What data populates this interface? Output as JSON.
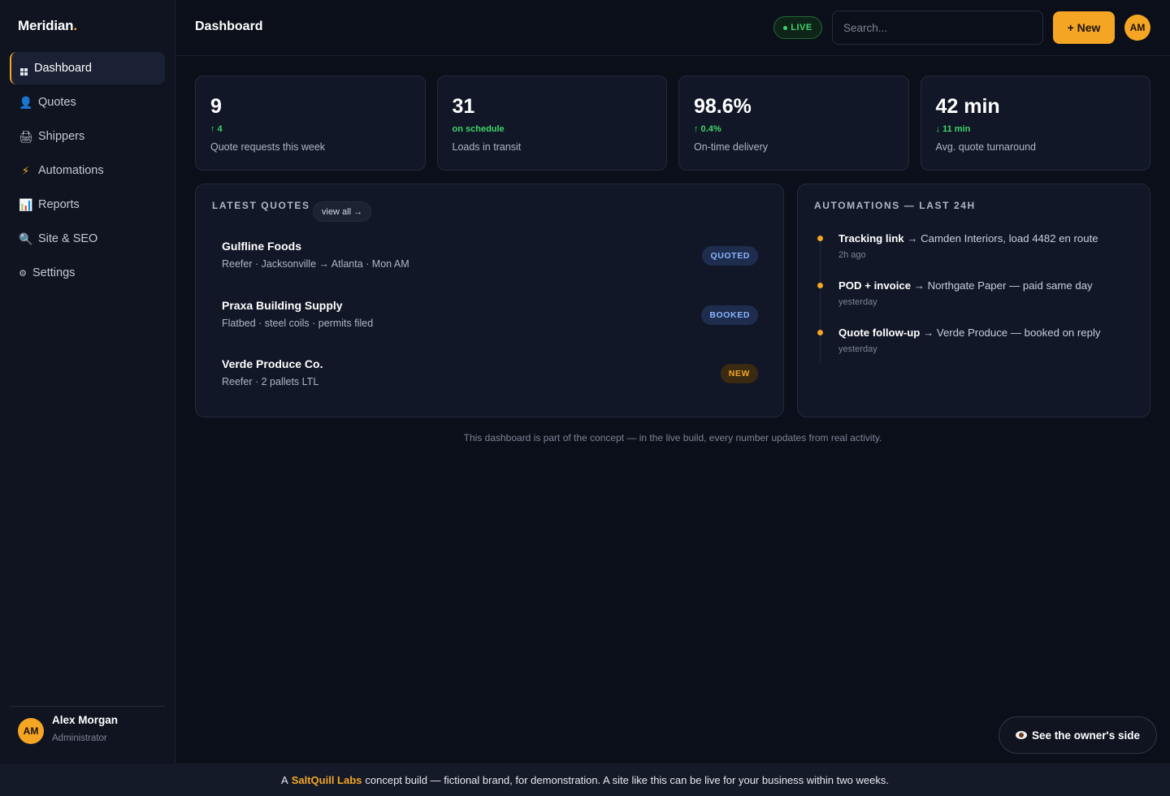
{
  "brand": {
    "name": "Meridian",
    "dot": "."
  },
  "nav": [
    {
      "label": "Dashboard",
      "icon": "grid-icon",
      "active": true
    },
    {
      "label": "Quotes",
      "icon": "user-icon",
      "glyph": "👤"
    },
    {
      "label": "Shippers",
      "icon": "printer-icon",
      "glyph": "🖨"
    },
    {
      "label": "Automations",
      "icon": "lightning-icon",
      "glyph": "⚡"
    },
    {
      "label": "Reports",
      "icon": "bar-chart-icon",
      "glyph": "📊"
    },
    {
      "label": "Site & SEO",
      "icon": "magnifier-icon",
      "glyph": "🔍"
    },
    {
      "label": "Settings",
      "icon": "gear-icon",
      "glyph": "⚙"
    }
  ],
  "user": {
    "initials": "AM",
    "name": "Alex Morgan",
    "role": "Administrator"
  },
  "header": {
    "title": "Dashboard",
    "live": "LIVE",
    "search_placeholder": "Search...",
    "new_label": "+ New",
    "avatar": "AM"
  },
  "stats": [
    {
      "value": "9",
      "delta": "↑ 4",
      "label": "Quote requests this week"
    },
    {
      "value": "31",
      "delta": "on schedule",
      "label": "Loads in transit"
    },
    {
      "value": "98.6%",
      "delta": "↑ 0.4%",
      "label": "On-time delivery"
    },
    {
      "value": "42 min",
      "delta": "↓ 11 min",
      "label": "Avg. quote turnaround"
    }
  ],
  "quotes": {
    "title": "Latest quotes",
    "view_all": "view all →",
    "items": [
      {
        "name": "Gulfline Foods",
        "meta": "Reefer · Jacksonville → Atlanta · Mon AM",
        "status": "QUOTED"
      },
      {
        "name": "Praxa Building Supply",
        "meta": "Flatbed · steel coils · permits filed",
        "status": "BOOKED"
      },
      {
        "name": "Verde Produce Co.",
        "meta": "Reefer · 2 pallets LTL",
        "status": "NEW"
      }
    ]
  },
  "automations": {
    "title": "Automations — last 24h",
    "items": [
      {
        "name": "Tracking link",
        "text": " → Camden Interiors, load 4482 en route",
        "time": "2h ago"
      },
      {
        "name": "POD + invoice",
        "text": " → Northgate Paper — paid same day",
        "time": "yesterday"
      },
      {
        "name": "Quote follow-up",
        "text": " → Verde Produce — booked on reply",
        "time": "yesterday"
      }
    ]
  },
  "note": "This dashboard is part of the concept — in the live build, every number updates from real activity.",
  "owner_button": "See the owner's side",
  "footer": {
    "prefix": "A",
    "brand": "SaltQuill Labs",
    "suffix": "concept build — fictional brand, for demonstration. A site like this can be live for your business within two weeks."
  },
  "colors": {
    "accent": "#f5a524",
    "success": "#3fd46b",
    "info": "#8ab4ff",
    "background": "#0b0f19"
  }
}
